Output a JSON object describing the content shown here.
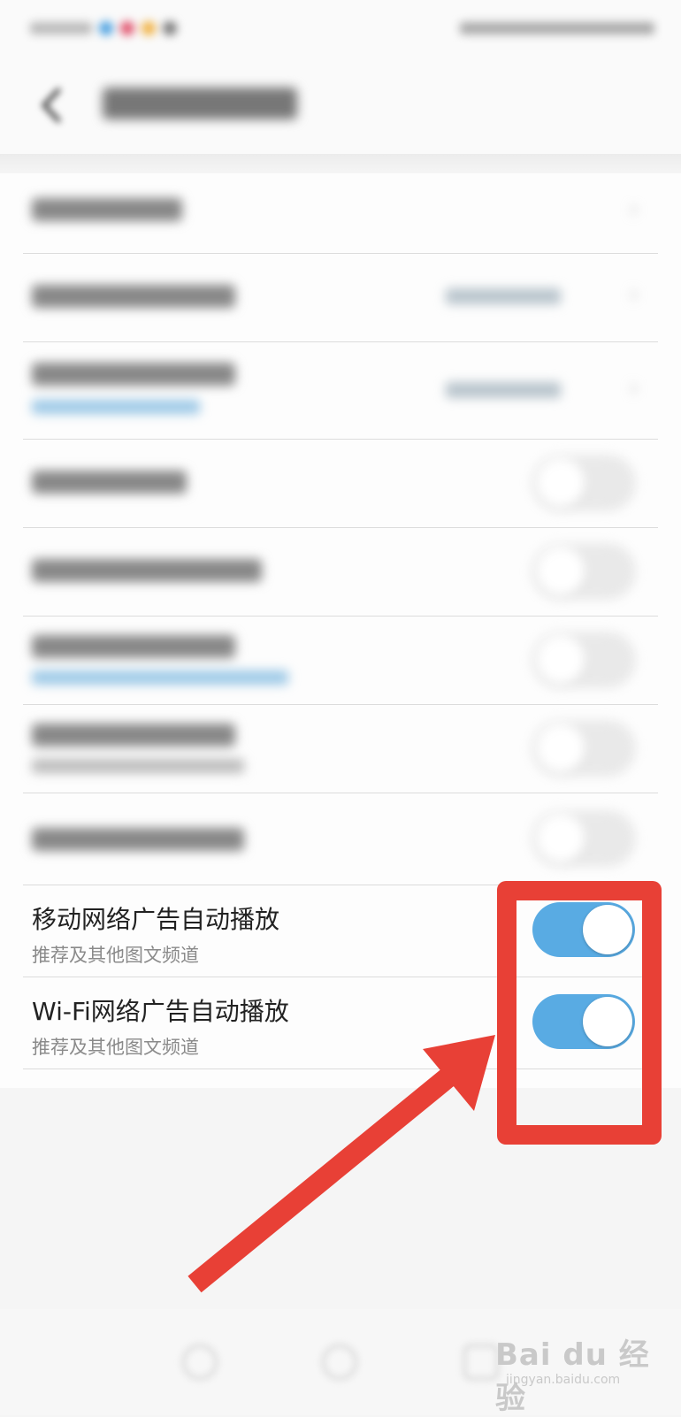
{
  "status_bar": {
    "left_text": "",
    "right_text": ""
  },
  "header": {
    "title": ""
  },
  "settings": {
    "blurred_rows": [
      {
        "title": "",
        "subtitle": "",
        "value": "",
        "control": "chevron"
      },
      {
        "title": "",
        "subtitle": "",
        "value": "",
        "control": "chevron"
      },
      {
        "title": "",
        "subtitle": "",
        "value": "",
        "control": "chevron"
      },
      {
        "title": "",
        "subtitle": "",
        "control": "toggle",
        "enabled": false
      },
      {
        "title": "",
        "subtitle": "",
        "control": "toggle",
        "enabled": false
      },
      {
        "title": "",
        "subtitle": "",
        "control": "toggle",
        "enabled": false
      },
      {
        "title": "",
        "subtitle": "",
        "control": "toggle",
        "enabled": false
      },
      {
        "title": "",
        "subtitle": "",
        "control": "toggle",
        "enabled": false
      }
    ],
    "mobile_ad_autoplay": {
      "title": "移动网络广告自动播放",
      "subtitle": "推荐及其他图文频道",
      "enabled": true
    },
    "wifi_ad_autoplay": {
      "title": "Wi-Fi网络广告自动播放",
      "subtitle": "推荐及其他图文频道",
      "enabled": true
    }
  },
  "colors": {
    "toggle_on": "#59abe3",
    "toggle_off": "#e9e9e9",
    "annotation_red": "#e84036"
  },
  "icons": [
    "back-arrow-icon",
    "chevron-right-icon",
    "toggle-switch-icon",
    "home-icon",
    "circle-icon",
    "square-icon"
  ],
  "watermark": {
    "main": "Bai du 经验",
    "sub": "jingyan.baidu.com"
  }
}
